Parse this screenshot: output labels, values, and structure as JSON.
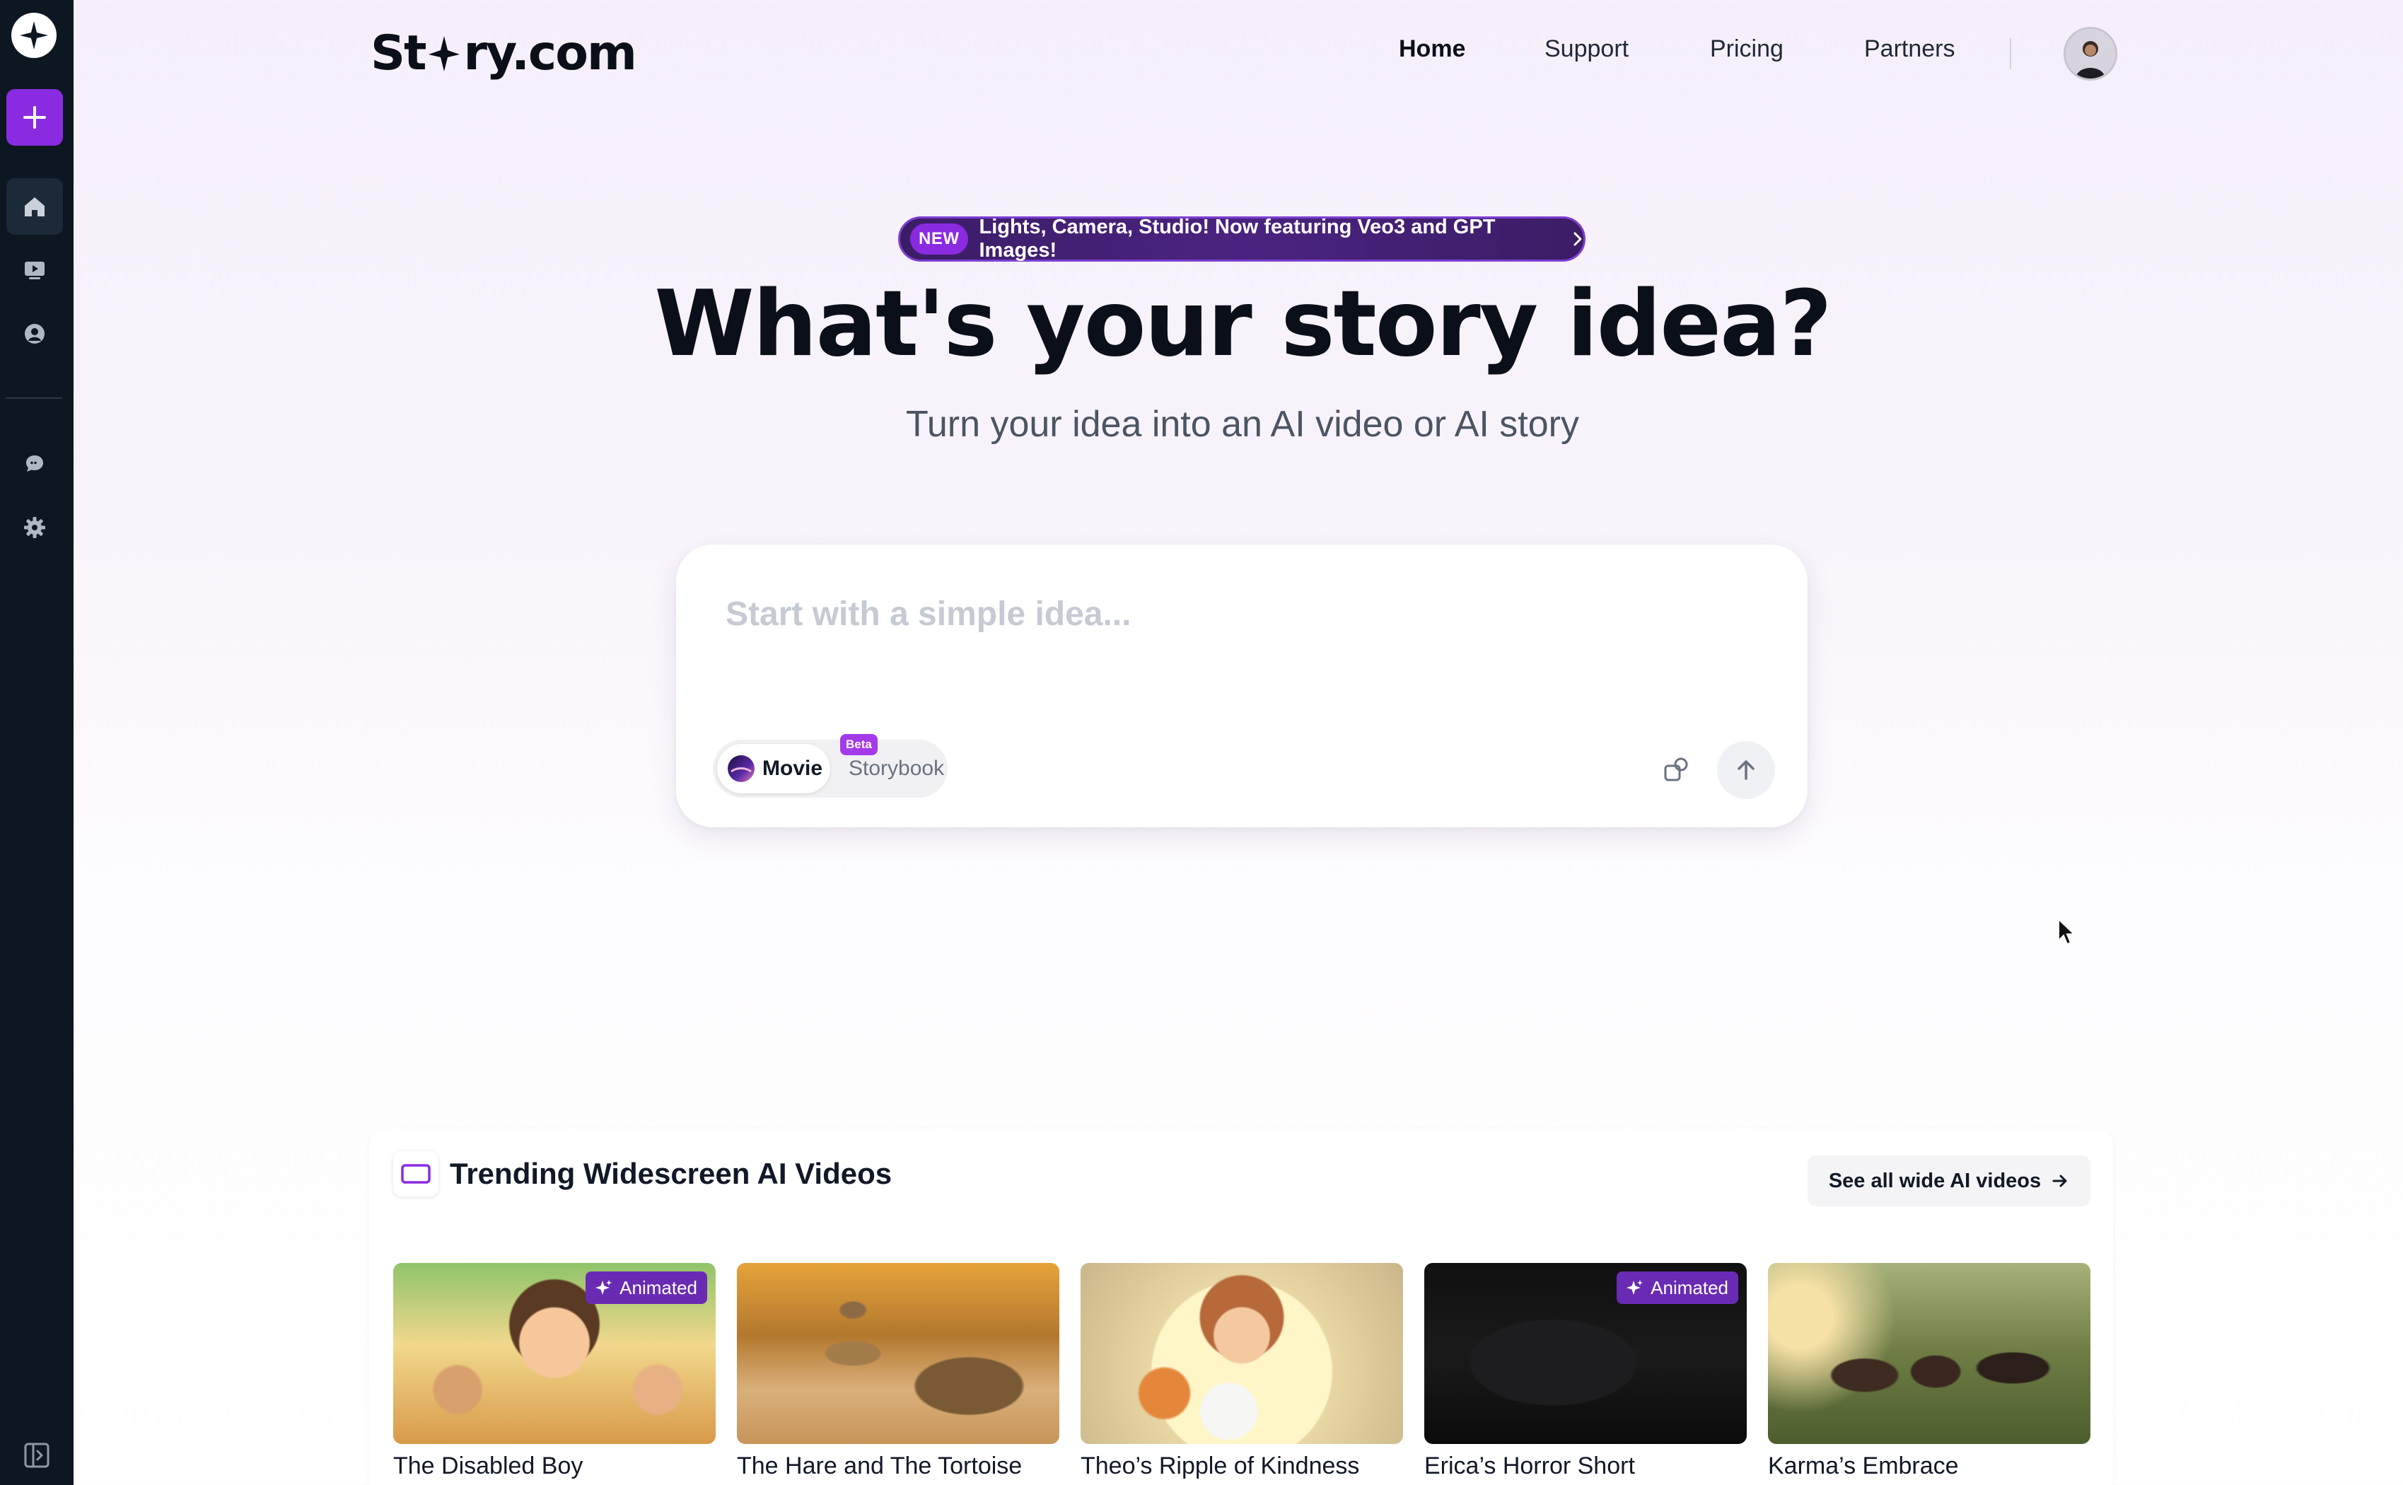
{
  "brand": {
    "name_part1": "St",
    "name_part2": "ry.com"
  },
  "nav": {
    "links": [
      "Home",
      "Support",
      "Pricing",
      "Partners"
    ],
    "active": "Home"
  },
  "sidebar": {
    "icons": [
      "logo-icon",
      "plus-icon",
      "home-icon",
      "video-library-icon",
      "profile-icon",
      "chat-icon",
      "gear-icon",
      "sidebar-toggle-icon"
    ]
  },
  "announcement": {
    "badge": "NEW",
    "text": "Lights, Camera, Studio! Now featuring Veo3 and GPT Images!"
  },
  "hero": {
    "title": "What's your story idea?",
    "subtitle": "Turn your idea into an AI video or AI story"
  },
  "prompt": {
    "placeholder": "Start with a simple idea...",
    "value": "",
    "modes": {
      "movie": "Movie",
      "movie_badge": "Beta",
      "storybook": "Storybook",
      "selected": "Movie"
    }
  },
  "trending": {
    "title": "Trending Widescreen AI Videos",
    "see_all": "See all wide AI videos",
    "badge_label": "Animated",
    "videos": [
      {
        "title": "The Disabled Boy",
        "animated": true
      },
      {
        "title": "The Hare and The Tortoise",
        "animated": false
      },
      {
        "title": "Theo’s Ripple of Kindness",
        "animated": false
      },
      {
        "title": "Erica’s Horror Short",
        "animated": true
      },
      {
        "title": "Karma’s Embrace",
        "animated": false
      }
    ]
  },
  "colors": {
    "accent": "#8a2be2",
    "sidebar_bg": "#0c1722",
    "badge_bg": "#6a2bb4"
  }
}
